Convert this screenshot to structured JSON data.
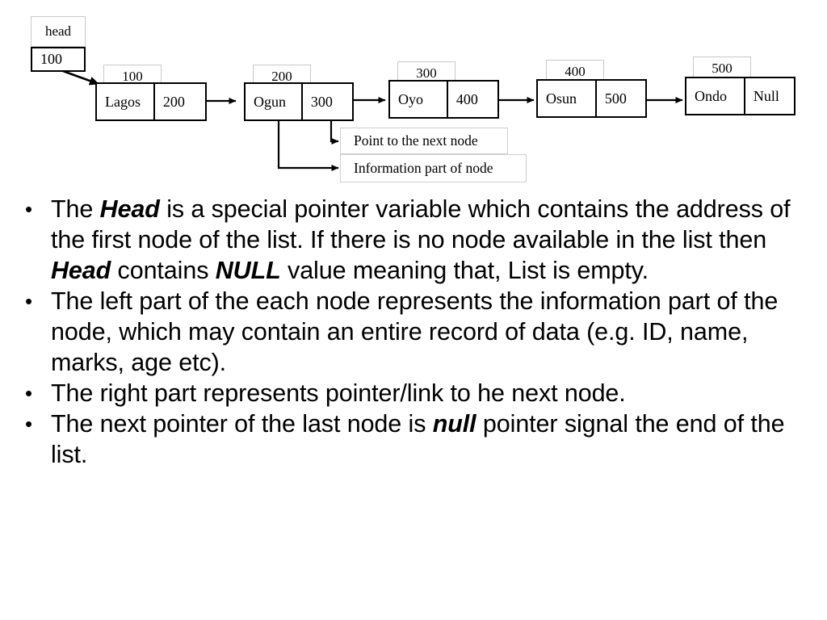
{
  "diagram": {
    "head": {
      "caption": "head",
      "value": "100"
    },
    "nodes": [
      {
        "address": "100",
        "info": "Lagos",
        "next": "200"
      },
      {
        "address": "200",
        "info": "Ogun",
        "next": "300"
      },
      {
        "address": "300",
        "info": "Oyo",
        "next": "400"
      },
      {
        "address": "400",
        "info": "Osun",
        "next": "500"
      },
      {
        "address": "500",
        "info": "Ondo",
        "next": "Null"
      }
    ],
    "callouts": {
      "pointer": "Point to the next node",
      "info": "Information part of node"
    }
  },
  "bullets": [
    {
      "parts": [
        {
          "text": "The ",
          "bold": false
        },
        {
          "text": "Head",
          "bold": true
        },
        {
          "text": " is a special pointer variable which contains the address of the first node of the list. If there is no node available in the list then ",
          "bold": false
        },
        {
          "text": "Head",
          "bold": true
        },
        {
          "text": " contains ",
          "bold": false
        },
        {
          "text": "NULL",
          "bold": true
        },
        {
          "text": " value meaning that, List is empty.",
          "bold": false
        }
      ]
    },
    {
      "parts": [
        {
          "text": "The left part of the each node represents the information part of the node, which may contain an entire record of data (e.g. ID, name, marks, age etc).",
          "bold": false
        }
      ]
    },
    {
      "parts": [
        {
          "text": "The right part represents pointer/link to he next node.",
          "bold": false
        }
      ]
    },
    {
      "parts": [
        {
          "text": "The next pointer of the last node is ",
          "bold": false
        },
        {
          "text": "null",
          "bold": true
        },
        {
          "text": " pointer signal the end of the list.",
          "bold": false
        }
      ]
    }
  ],
  "colors": {
    "node_border": "#000000",
    "label_border": "#c9c9c9",
    "background": "#ffffff",
    "text": "#000000"
  }
}
